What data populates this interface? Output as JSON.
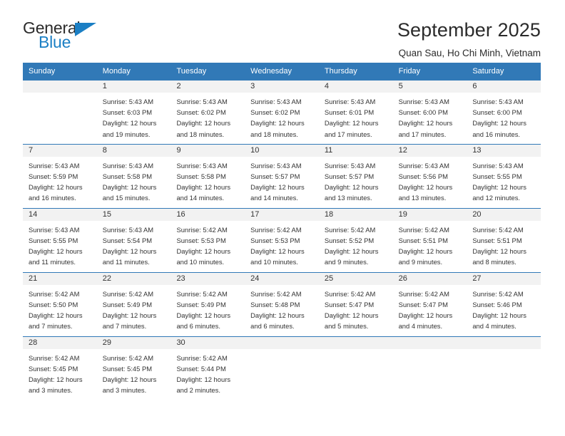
{
  "brand": {
    "name_part1": "General",
    "name_part2": "Blue",
    "triangle_color": "#1b7fc4",
    "accent_color": "#3179b7"
  },
  "header": {
    "title": "September 2025",
    "subtitle": "Quan Sau, Ho Chi Minh, Vietnam"
  },
  "calendar": {
    "weekday_headers": [
      "Sunday",
      "Monday",
      "Tuesday",
      "Wednesday",
      "Thursday",
      "Friday",
      "Saturday"
    ],
    "weeks": [
      [
        {
          "day": "",
          "sunrise": "",
          "sunset": "",
          "daylight_line1": "",
          "daylight_line2": "",
          "empty": true
        },
        {
          "day": "1",
          "sunrise": "Sunrise: 5:43 AM",
          "sunset": "Sunset: 6:03 PM",
          "daylight_line1": "Daylight: 12 hours",
          "daylight_line2": "and 19 minutes.",
          "empty": false
        },
        {
          "day": "2",
          "sunrise": "Sunrise: 5:43 AM",
          "sunset": "Sunset: 6:02 PM",
          "daylight_line1": "Daylight: 12 hours",
          "daylight_line2": "and 18 minutes.",
          "empty": false
        },
        {
          "day": "3",
          "sunrise": "Sunrise: 5:43 AM",
          "sunset": "Sunset: 6:02 PM",
          "daylight_line1": "Daylight: 12 hours",
          "daylight_line2": "and 18 minutes.",
          "empty": false
        },
        {
          "day": "4",
          "sunrise": "Sunrise: 5:43 AM",
          "sunset": "Sunset: 6:01 PM",
          "daylight_line1": "Daylight: 12 hours",
          "daylight_line2": "and 17 minutes.",
          "empty": false
        },
        {
          "day": "5",
          "sunrise": "Sunrise: 5:43 AM",
          "sunset": "Sunset: 6:00 PM",
          "daylight_line1": "Daylight: 12 hours",
          "daylight_line2": "and 17 minutes.",
          "empty": false
        },
        {
          "day": "6",
          "sunrise": "Sunrise: 5:43 AM",
          "sunset": "Sunset: 6:00 PM",
          "daylight_line1": "Daylight: 12 hours",
          "daylight_line2": "and 16 minutes.",
          "empty": false
        }
      ],
      [
        {
          "day": "7",
          "sunrise": "Sunrise: 5:43 AM",
          "sunset": "Sunset: 5:59 PM",
          "daylight_line1": "Daylight: 12 hours",
          "daylight_line2": "and 16 minutes.",
          "empty": false
        },
        {
          "day": "8",
          "sunrise": "Sunrise: 5:43 AM",
          "sunset": "Sunset: 5:58 PM",
          "daylight_line1": "Daylight: 12 hours",
          "daylight_line2": "and 15 minutes.",
          "empty": false
        },
        {
          "day": "9",
          "sunrise": "Sunrise: 5:43 AM",
          "sunset": "Sunset: 5:58 PM",
          "daylight_line1": "Daylight: 12 hours",
          "daylight_line2": "and 14 minutes.",
          "empty": false
        },
        {
          "day": "10",
          "sunrise": "Sunrise: 5:43 AM",
          "sunset": "Sunset: 5:57 PM",
          "daylight_line1": "Daylight: 12 hours",
          "daylight_line2": "and 14 minutes.",
          "empty": false
        },
        {
          "day": "11",
          "sunrise": "Sunrise: 5:43 AM",
          "sunset": "Sunset: 5:57 PM",
          "daylight_line1": "Daylight: 12 hours",
          "daylight_line2": "and 13 minutes.",
          "empty": false
        },
        {
          "day": "12",
          "sunrise": "Sunrise: 5:43 AM",
          "sunset": "Sunset: 5:56 PM",
          "daylight_line1": "Daylight: 12 hours",
          "daylight_line2": "and 13 minutes.",
          "empty": false
        },
        {
          "day": "13",
          "sunrise": "Sunrise: 5:43 AM",
          "sunset": "Sunset: 5:55 PM",
          "daylight_line1": "Daylight: 12 hours",
          "daylight_line2": "and 12 minutes.",
          "empty": false
        }
      ],
      [
        {
          "day": "14",
          "sunrise": "Sunrise: 5:43 AM",
          "sunset": "Sunset: 5:55 PM",
          "daylight_line1": "Daylight: 12 hours",
          "daylight_line2": "and 11 minutes.",
          "empty": false
        },
        {
          "day": "15",
          "sunrise": "Sunrise: 5:43 AM",
          "sunset": "Sunset: 5:54 PM",
          "daylight_line1": "Daylight: 12 hours",
          "daylight_line2": "and 11 minutes.",
          "empty": false
        },
        {
          "day": "16",
          "sunrise": "Sunrise: 5:42 AM",
          "sunset": "Sunset: 5:53 PM",
          "daylight_line1": "Daylight: 12 hours",
          "daylight_line2": "and 10 minutes.",
          "empty": false
        },
        {
          "day": "17",
          "sunrise": "Sunrise: 5:42 AM",
          "sunset": "Sunset: 5:53 PM",
          "daylight_line1": "Daylight: 12 hours",
          "daylight_line2": "and 10 minutes.",
          "empty": false
        },
        {
          "day": "18",
          "sunrise": "Sunrise: 5:42 AM",
          "sunset": "Sunset: 5:52 PM",
          "daylight_line1": "Daylight: 12 hours",
          "daylight_line2": "and 9 minutes.",
          "empty": false
        },
        {
          "day": "19",
          "sunrise": "Sunrise: 5:42 AM",
          "sunset": "Sunset: 5:51 PM",
          "daylight_line1": "Daylight: 12 hours",
          "daylight_line2": "and 9 minutes.",
          "empty": false
        },
        {
          "day": "20",
          "sunrise": "Sunrise: 5:42 AM",
          "sunset": "Sunset: 5:51 PM",
          "daylight_line1": "Daylight: 12 hours",
          "daylight_line2": "and 8 minutes.",
          "empty": false
        }
      ],
      [
        {
          "day": "21",
          "sunrise": "Sunrise: 5:42 AM",
          "sunset": "Sunset: 5:50 PM",
          "daylight_line1": "Daylight: 12 hours",
          "daylight_line2": "and 7 minutes.",
          "empty": false
        },
        {
          "day": "22",
          "sunrise": "Sunrise: 5:42 AM",
          "sunset": "Sunset: 5:49 PM",
          "daylight_line1": "Daylight: 12 hours",
          "daylight_line2": "and 7 minutes.",
          "empty": false
        },
        {
          "day": "23",
          "sunrise": "Sunrise: 5:42 AM",
          "sunset": "Sunset: 5:49 PM",
          "daylight_line1": "Daylight: 12 hours",
          "daylight_line2": "and 6 minutes.",
          "empty": false
        },
        {
          "day": "24",
          "sunrise": "Sunrise: 5:42 AM",
          "sunset": "Sunset: 5:48 PM",
          "daylight_line1": "Daylight: 12 hours",
          "daylight_line2": "and 6 minutes.",
          "empty": false
        },
        {
          "day": "25",
          "sunrise": "Sunrise: 5:42 AM",
          "sunset": "Sunset: 5:47 PM",
          "daylight_line1": "Daylight: 12 hours",
          "daylight_line2": "and 5 minutes.",
          "empty": false
        },
        {
          "day": "26",
          "sunrise": "Sunrise: 5:42 AM",
          "sunset": "Sunset: 5:47 PM",
          "daylight_line1": "Daylight: 12 hours",
          "daylight_line2": "and 4 minutes.",
          "empty": false
        },
        {
          "day": "27",
          "sunrise": "Sunrise: 5:42 AM",
          "sunset": "Sunset: 5:46 PM",
          "daylight_line1": "Daylight: 12 hours",
          "daylight_line2": "and 4 minutes.",
          "empty": false
        }
      ],
      [
        {
          "day": "28",
          "sunrise": "Sunrise: 5:42 AM",
          "sunset": "Sunset: 5:45 PM",
          "daylight_line1": "Daylight: 12 hours",
          "daylight_line2": "and 3 minutes.",
          "empty": false
        },
        {
          "day": "29",
          "sunrise": "Sunrise: 5:42 AM",
          "sunset": "Sunset: 5:45 PM",
          "daylight_line1": "Daylight: 12 hours",
          "daylight_line2": "and 3 minutes.",
          "empty": false
        },
        {
          "day": "30",
          "sunrise": "Sunrise: 5:42 AM",
          "sunset": "Sunset: 5:44 PM",
          "daylight_line1": "Daylight: 12 hours",
          "daylight_line2": "and 2 minutes.",
          "empty": false
        },
        {
          "day": "",
          "sunrise": "",
          "sunset": "",
          "daylight_line1": "",
          "daylight_line2": "",
          "empty": true
        },
        {
          "day": "",
          "sunrise": "",
          "sunset": "",
          "daylight_line1": "",
          "daylight_line2": "",
          "empty": true
        },
        {
          "day": "",
          "sunrise": "",
          "sunset": "",
          "daylight_line1": "",
          "daylight_line2": "",
          "empty": true
        },
        {
          "day": "",
          "sunrise": "",
          "sunset": "",
          "daylight_line1": "",
          "daylight_line2": "",
          "empty": true
        }
      ]
    ]
  }
}
